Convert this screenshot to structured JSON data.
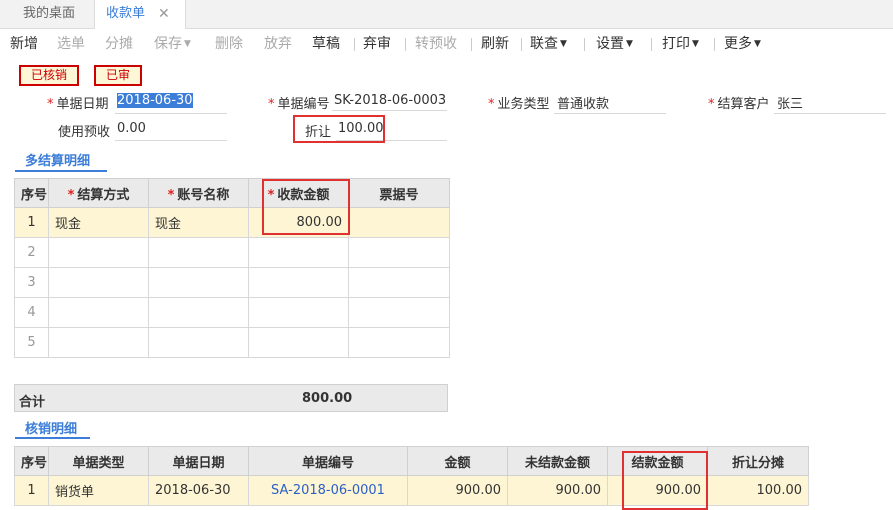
{
  "tabs": {
    "home": "我的桌面",
    "active": "收款单",
    "close": "✕"
  },
  "toolbar": {
    "new": "新增",
    "select_doc": "选单",
    "allocate": "分摊",
    "save": "保存",
    "delete": "删除",
    "abandon": "放弃",
    "draft": "草稿",
    "audit": "弃审",
    "to_prepay": "转预收",
    "refresh": "刷新",
    "link_query": "联查",
    "settings": "设置",
    "print": "打印",
    "more": "更多"
  },
  "status": {
    "written_off": "已核销",
    "audited": "已审"
  },
  "form": {
    "doc_date_label": "单据日期",
    "doc_date": "2018-06-30",
    "doc_no_label": "单据编号",
    "doc_no": "SK-2018-06-0003",
    "biz_type_label": "业务类型",
    "biz_type": "普通收款",
    "customer_label": "结算客户",
    "customer": "张三",
    "prepay_label": "使用预收",
    "prepay": "0.00",
    "discount_label": "折让",
    "discount": "100.00"
  },
  "settlement": {
    "title": "多结算明细",
    "columns": [
      "序号",
      "结算方式",
      "账号名称",
      "收款金额",
      "票据号"
    ],
    "rows": [
      {
        "idx": "1",
        "method": "现金",
        "account": "现金",
        "amount": "800.00",
        "bill": ""
      },
      {
        "idx": "2",
        "method": "",
        "account": "",
        "amount": "",
        "bill": ""
      },
      {
        "idx": "3",
        "method": "",
        "account": "",
        "amount": "",
        "bill": ""
      },
      {
        "idx": "4",
        "method": "",
        "account": "",
        "amount": "",
        "bill": ""
      },
      {
        "idx": "5",
        "method": "",
        "account": "",
        "amount": "",
        "bill": ""
      }
    ],
    "total_label": "合计",
    "total": "800.00"
  },
  "writeoff": {
    "title": "核销明细",
    "columns": [
      "序号",
      "单据类型",
      "单据日期",
      "单据编号",
      "金额",
      "未结款金额",
      "结款金额",
      "折让分摊"
    ],
    "rows": [
      {
        "idx": "1",
        "type": "销货单",
        "date": "2018-06-30",
        "no": "SA-2018-06-0001",
        "amount": "900.00",
        "unsettled": "900.00",
        "settled": "900.00",
        "discount": "100.00"
      }
    ]
  },
  "colors": {
    "accent": "#3b7dd8",
    "highlight_row": "#fdf5d3",
    "annotation": "#e03030",
    "stamp": "#cc0000"
  }
}
